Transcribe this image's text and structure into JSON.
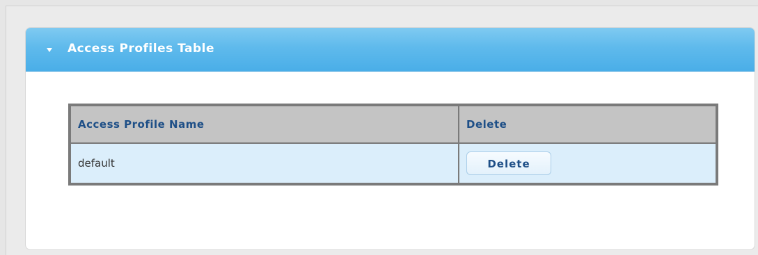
{
  "panel": {
    "title": "Access Profiles Table",
    "toggle_icon": "caret-down-icon"
  },
  "table": {
    "headers": [
      "Access Profile Name",
      "Delete"
    ],
    "rows": [
      {
        "name": "default",
        "action_label": "Delete"
      }
    ]
  },
  "colors": {
    "header_blue": "#5fbaec",
    "table_header_bg": "#c4c4c4",
    "row_bg": "#dbeefb",
    "header_text": "#1e4f87"
  }
}
